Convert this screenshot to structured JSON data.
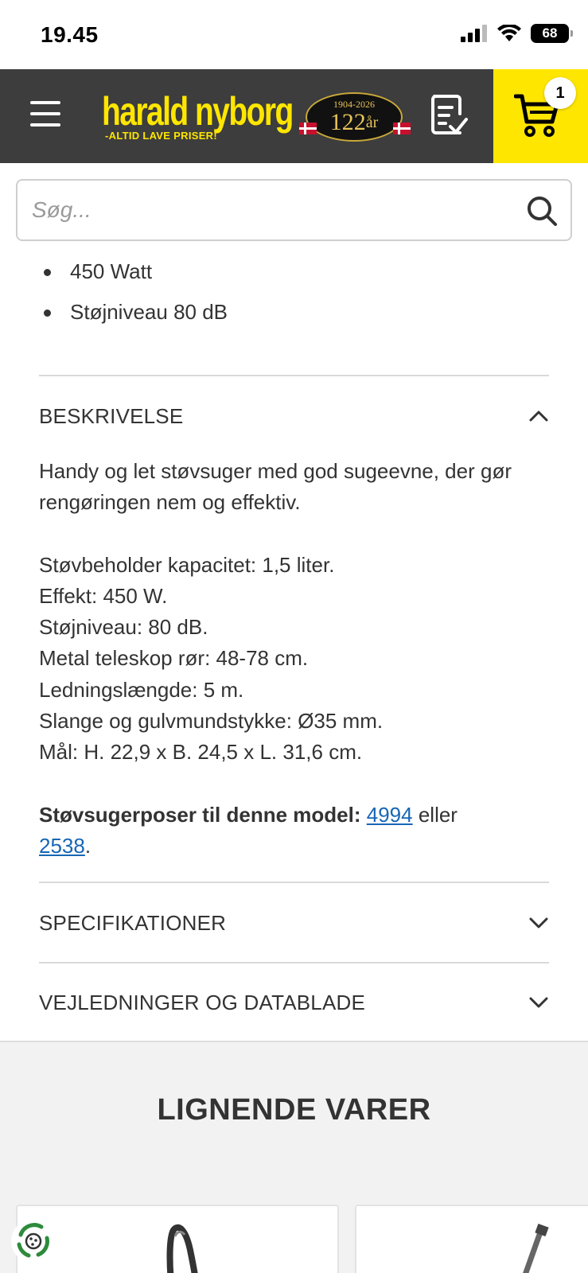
{
  "status_bar": {
    "time": "19.45",
    "battery": "68"
  },
  "header": {
    "logo_text": "harald nyborg",
    "logo_tagline": "-ALTID LAVE PRISER!",
    "anniversary_years": "1904-2026",
    "anniversary_number": "122",
    "anniversary_suffix": "år",
    "cart_count": "1",
    "brand_color": "#ffe600",
    "header_color": "#3d3d3d"
  },
  "search": {
    "placeholder": "Søg..."
  },
  "bullets": [
    "450 Watt",
    "Støjniveau 80 dB"
  ],
  "accordions": {
    "description": {
      "title": "BESKRIVELSE",
      "expanded": true,
      "intro": "Handy og let støvsuger med god sugeevne, der gør rengøringen nem og effektiv.",
      "specs": [
        "Støvbeholder kapacitet: 1,5 liter.",
        "Effekt: 450 W.",
        "Støjniveau: 80 dB.",
        "Metal teleskop rør: 48-78 cm.",
        "Ledningslængde: 5 m.",
        "Slange og gulvmundstykke: Ø35 mm.",
        "Mål: H. 22,9 x B. 24,5 x L. 31,6 cm."
      ],
      "bags_label": "Støvsugerposer til denne model:",
      "bag_link_1": "4994",
      "bags_or": "eller",
      "bag_link_2": "2538",
      "bags_end": "."
    },
    "specifications": {
      "title": "SPECIFIKATIONER",
      "expanded": false
    },
    "guides": {
      "title": "VEJLEDNINGER OG DATABLADE",
      "expanded": false
    }
  },
  "similar": {
    "title": "LIGNENDE VARER"
  },
  "link_color": "#1766b5"
}
